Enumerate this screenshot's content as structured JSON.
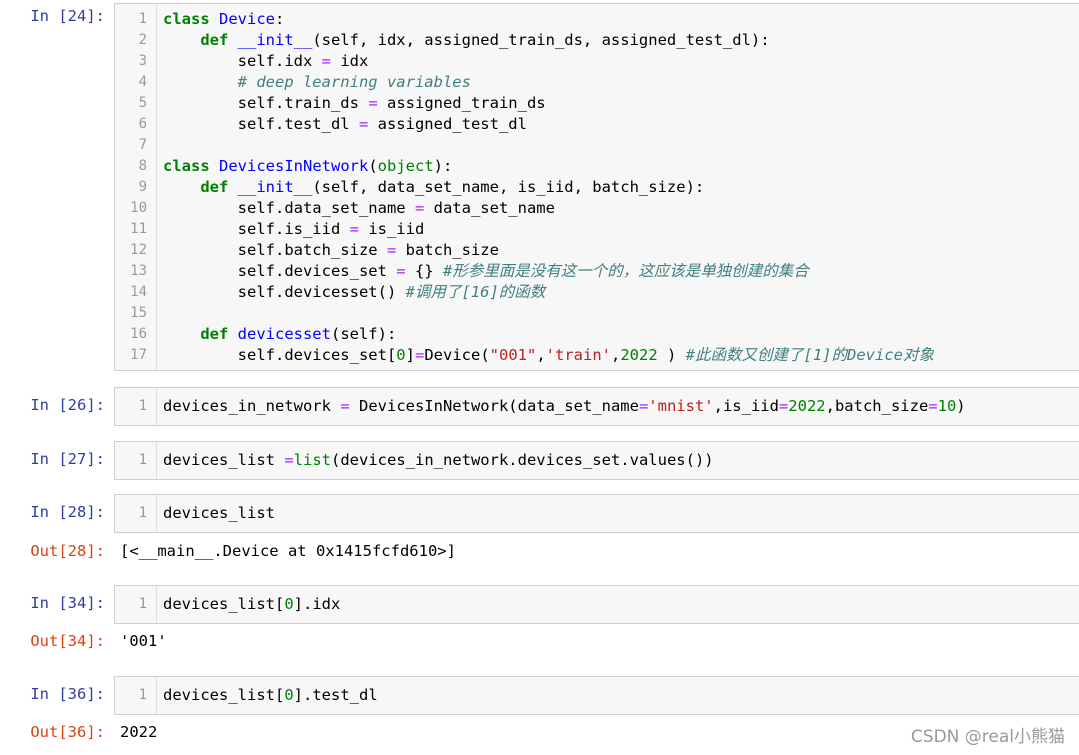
{
  "cells": [
    {
      "prompt": "In  [24]:",
      "lines": [
        {
          "n": "1",
          "segs": [
            [
              "kw",
              "class "
            ],
            [
              "def",
              "Device"
            ],
            [
              "",
              ":"
            ]
          ]
        },
        {
          "n": "2",
          "segs": [
            [
              "",
              "    "
            ],
            [
              "kw",
              "def "
            ],
            [
              "def",
              "__init__"
            ],
            [
              "",
              "(self, idx, assigned_train_ds, assigned_test_dl):"
            ]
          ]
        },
        {
          "n": "3",
          "segs": [
            [
              "",
              "        self.idx "
            ],
            [
              "op",
              "="
            ],
            [
              "",
              " idx"
            ]
          ]
        },
        {
          "n": "4",
          "segs": [
            [
              "",
              "        "
            ],
            [
              "cm",
              "# deep learning variables"
            ]
          ]
        },
        {
          "n": "5",
          "segs": [
            [
              "",
              "        self.train_ds "
            ],
            [
              "op",
              "="
            ],
            [
              "",
              " assigned_train_ds"
            ]
          ]
        },
        {
          "n": "6",
          "segs": [
            [
              "",
              "        self.test_dl "
            ],
            [
              "op",
              "="
            ],
            [
              "",
              " assigned_test_dl"
            ]
          ]
        },
        {
          "n": "7",
          "segs": [
            [
              "",
              ""
            ]
          ]
        },
        {
          "n": "8",
          "segs": [
            [
              "kw",
              "class "
            ],
            [
              "def",
              "DevicesInNetwork"
            ],
            [
              "",
              "("
            ],
            [
              "builtin",
              "object"
            ],
            [
              "",
              "):"
            ]
          ]
        },
        {
          "n": "9",
          "segs": [
            [
              "",
              "    "
            ],
            [
              "kw",
              "def "
            ],
            [
              "def",
              "__init__"
            ],
            [
              "",
              "(self, data_set_name, is_iid, batch_size):"
            ]
          ]
        },
        {
          "n": "10",
          "segs": [
            [
              "",
              "        self.data_set_name "
            ],
            [
              "op",
              "="
            ],
            [
              "",
              " data_set_name"
            ]
          ]
        },
        {
          "n": "11",
          "segs": [
            [
              "",
              "        self.is_iid "
            ],
            [
              "op",
              "="
            ],
            [
              "",
              " is_iid"
            ]
          ]
        },
        {
          "n": "12",
          "segs": [
            [
              "",
              "        self.batch_size "
            ],
            [
              "op",
              "="
            ],
            [
              "",
              " batch_size"
            ]
          ]
        },
        {
          "n": "13",
          "segs": [
            [
              "",
              "        self.devices_set "
            ],
            [
              "op",
              "="
            ],
            [
              "",
              " {} "
            ],
            [
              "cm",
              "#形参里面是没有这一个的，这应该是单独创建的集合"
            ]
          ]
        },
        {
          "n": "14",
          "segs": [
            [
              "",
              "        self.devicesset() "
            ],
            [
              "cm",
              "#调用了[16]的函数"
            ]
          ]
        },
        {
          "n": "15",
          "segs": [
            [
              "",
              ""
            ]
          ]
        },
        {
          "n": "16",
          "segs": [
            [
              "",
              "    "
            ],
            [
              "kw",
              "def "
            ],
            [
              "def",
              "devicesset"
            ],
            [
              "",
              "(self):"
            ]
          ]
        },
        {
          "n": "17",
          "segs": [
            [
              "",
              "        self.devices_set["
            ],
            [
              "num",
              "0"
            ],
            [
              "",
              "]"
            ],
            [
              "op",
              "="
            ],
            [
              "",
              "Device("
            ],
            [
              "str",
              "\"001\""
            ],
            [
              "",
              ","
            ],
            [
              "str",
              "'train'"
            ],
            [
              "",
              ","
            ],
            [
              "num",
              "2022"
            ],
            [
              "",
              " ) "
            ],
            [
              "cm",
              "#此函数又创建了[1]的Device对象"
            ]
          ]
        }
      ]
    },
    {
      "prompt": "In  [26]:",
      "lines": [
        {
          "n": "1",
          "segs": [
            [
              "",
              "devices_in_network "
            ],
            [
              "op",
              "="
            ],
            [
              "",
              " DevicesInNetwork(data_set_name"
            ],
            [
              "op",
              "="
            ],
            [
              "str",
              "'mnist'"
            ],
            [
              "",
              ",is_iid"
            ],
            [
              "op",
              "="
            ],
            [
              "num",
              "2022"
            ],
            [
              "",
              ",batch_size"
            ],
            [
              "op",
              "="
            ],
            [
              "num",
              "10"
            ],
            [
              "",
              ")"
            ]
          ]
        }
      ]
    },
    {
      "prompt": "In  [27]:",
      "lines": [
        {
          "n": "1",
          "segs": [
            [
              "",
              "devices_list "
            ],
            [
              "op",
              "="
            ],
            [
              " ",
              ""
            ],
            [
              "builtin",
              "list"
            ],
            [
              "",
              "(devices_in_network.devices_set.values())"
            ]
          ]
        }
      ]
    },
    {
      "prompt": "In  [28]:",
      "lines": [
        {
          "n": "1",
          "segs": [
            [
              "",
              "devices_list"
            ]
          ]
        }
      ],
      "out_prompt": "Out[28]:",
      "output": "[<__main__.Device at 0x1415fcfd610>]"
    },
    {
      "prompt": "In  [34]:",
      "lines": [
        {
          "n": "1",
          "segs": [
            [
              "",
              "devices_list["
            ],
            [
              "num",
              "0"
            ],
            [
              "",
              "].idx"
            ]
          ]
        }
      ],
      "out_prompt": "Out[34]:",
      "output": "'001'"
    },
    {
      "prompt": "In  [36]:",
      "lines": [
        {
          "n": "1",
          "segs": [
            [
              "",
              "devices_list["
            ],
            [
              "num",
              "0"
            ],
            [
              "",
              "].test_dl"
            ]
          ]
        }
      ],
      "out_prompt": "Out[36]:",
      "output": "2022"
    }
  ],
  "watermark": "CSDN @real小熊猫"
}
